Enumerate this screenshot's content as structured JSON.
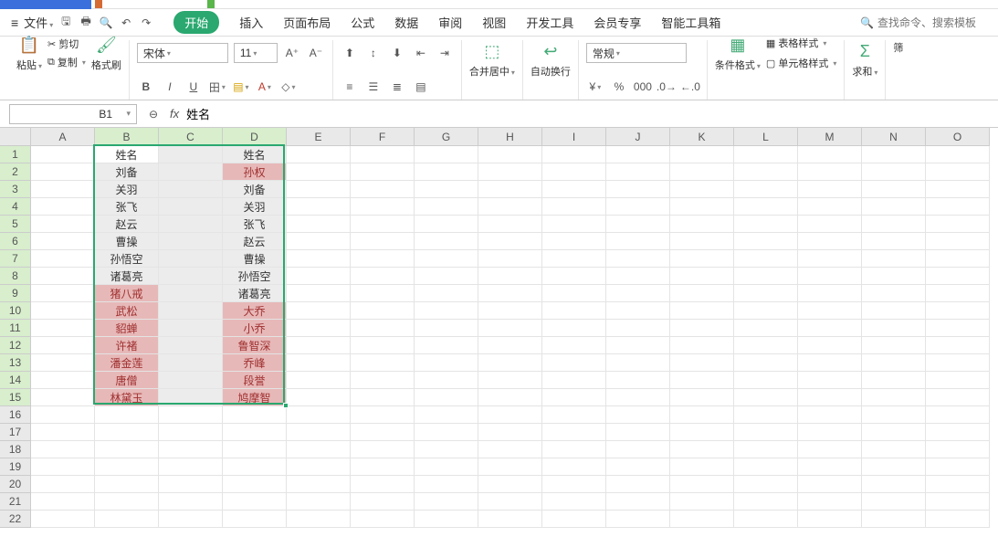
{
  "file_menu": {
    "label": "文件"
  },
  "ribbon_tabs": [
    "开始",
    "插入",
    "页面布局",
    "公式",
    "数据",
    "审阅",
    "视图",
    "开发工具",
    "会员专享",
    "智能工具箱"
  ],
  "search_placeholder": "查找命令、搜索模板",
  "clipboard": {
    "paste": "粘贴",
    "cut": "剪切",
    "copy": "复制",
    "format_painter": "格式刷"
  },
  "font": {
    "name": "宋体",
    "size": "11"
  },
  "merge": {
    "label": "合并居中"
  },
  "wrap": {
    "label": "自动换行"
  },
  "number_format": {
    "value": "常规"
  },
  "styles": {
    "conditional": "条件格式",
    "table": "表格样式",
    "cell": "单元格样式"
  },
  "sum": {
    "label": "求和"
  },
  "name_box": "B1",
  "formula_value": "姓名",
  "columns": [
    "A",
    "B",
    "C",
    "D",
    "E",
    "F",
    "G",
    "H",
    "I",
    "J",
    "K",
    "L",
    "M",
    "N",
    "O"
  ],
  "row_count": 22,
  "selected_cols": [
    "B",
    "C",
    "D"
  ],
  "selected_rows_from": 1,
  "selected_rows_to": 15,
  "data": {
    "B": {
      "1": "姓名",
      "2": "刘备",
      "3": "关羽",
      "4": "张飞",
      "5": "赵云",
      "6": "曹操",
      "7": "孙悟空",
      "8": "诸葛亮",
      "9": "猪八戒",
      "10": "武松",
      "11": "貂蝉",
      "12": "许褚",
      "13": "潘金莲",
      "14": "唐僧",
      "15": "林黛玉"
    },
    "D": {
      "1": "姓名",
      "2": "孙权",
      "3": "刘备",
      "4": "关羽",
      "5": "张飞",
      "6": "赵云",
      "7": "曹操",
      "8": "孙悟空",
      "9": "诸葛亮",
      "10": "大乔",
      "11": "小乔",
      "12": "鲁智深",
      "13": "乔峰",
      "14": "段誉",
      "15": "鸠摩智"
    }
  },
  "pink_cells": {
    "B": [
      9,
      10,
      11,
      12,
      13,
      14,
      15
    ],
    "D": [
      2,
      10,
      11,
      12,
      13,
      14,
      15
    ]
  }
}
